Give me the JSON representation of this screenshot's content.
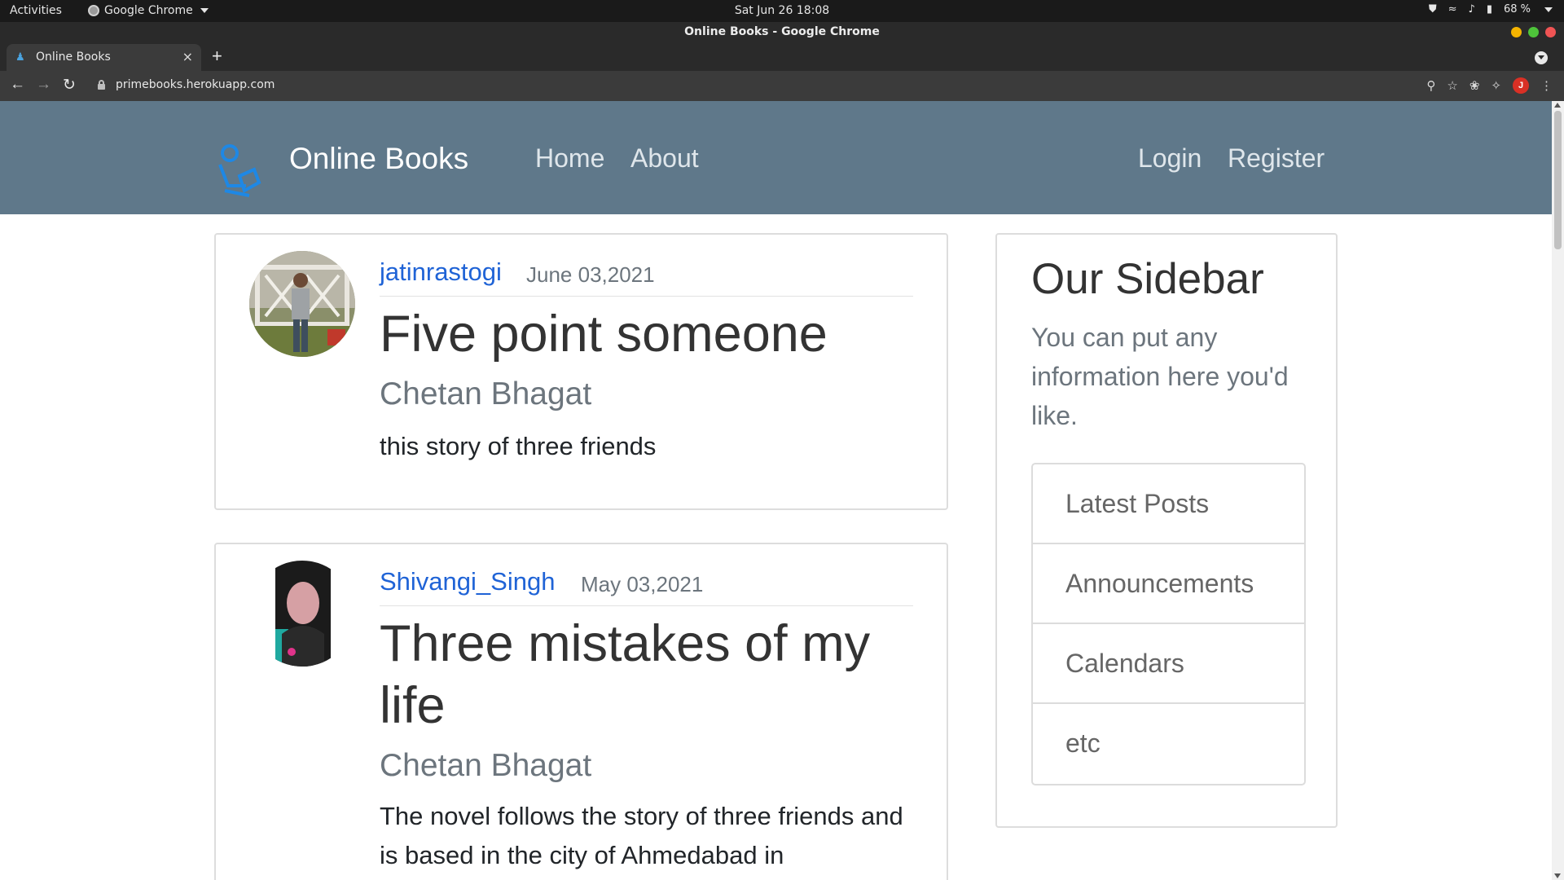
{
  "os": {
    "activities": "Activities",
    "app_name": "Google Chrome",
    "clock": "Sat Jun 26  18:08",
    "battery": "68 %"
  },
  "browser": {
    "window_title": "Online Books - Google Chrome",
    "tab_title": "Online Books",
    "url": "primebooks.herokuapp.com",
    "profile_initial": "J"
  },
  "site": {
    "brand": "Online Books",
    "nav": {
      "home": "Home",
      "about": "About",
      "login": "Login",
      "register": "Register"
    }
  },
  "posts": [
    {
      "author": "jatinrastogi",
      "date": "June 03,2021",
      "title": "Five point someone",
      "book_author": "Chetan Bhagat",
      "body": "this story of three friends"
    },
    {
      "author": "Shivangi_Singh",
      "date": "May 03,2021",
      "title": "Three mistakes of my life",
      "book_author": "Chetan Bhagat",
      "body": "The novel follows the story of three friends and is based in the city of Ahmedabad in"
    }
  ],
  "sidebar": {
    "title": "Our Sidebar",
    "text": "You can put any information here you'd like.",
    "items": [
      "Latest Posts",
      "Announcements",
      "Calendars",
      "etc"
    ]
  },
  "colors": {
    "navbar": "#5f788a",
    "link": "#1f63d6",
    "logo": "#1e88e5"
  }
}
